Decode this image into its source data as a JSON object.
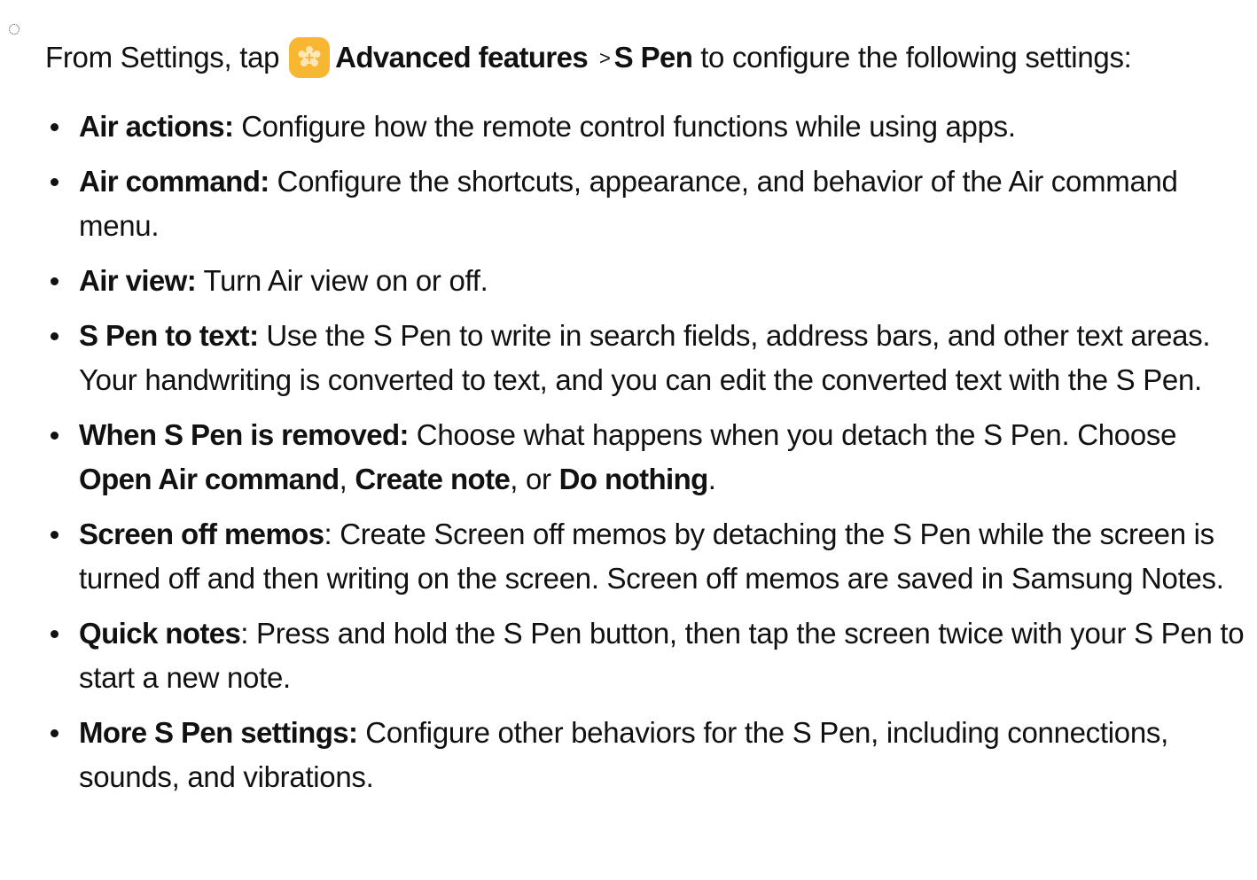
{
  "intro": {
    "prefix": "From Settings, tap",
    "icon": "advanced-features-icon",
    "path_1": "Advanced features",
    "separator": ">",
    "path_2": "S Pen",
    "suffix": "to configure the following settings:"
  },
  "settings": [
    {
      "term": "Air actions:",
      "description": "Configure how the remote control functions while using apps."
    },
    {
      "term": "Air command:",
      "description": "Configure the shortcuts, appearance, and behavior of the Air command menu."
    },
    {
      "term": "Air view:",
      "description": "Turn Air view on or off."
    },
    {
      "term": "S Pen to text:",
      "description": "Use the S Pen to write in search fields, address bars, and other text areas. Your handwriting is converted to text, and you can edit the converted text with the S Pen."
    },
    {
      "term": "When S Pen is removed:",
      "description": "Choose what happens when you detach the S Pen. Choose",
      "option_1": "Open Air command",
      "comma": ",",
      "option_2": "Create note",
      "or_text": ", or",
      "option_3": "Do nothing",
      "end": "."
    },
    {
      "term": "Screen off memos",
      "colon": ":",
      "description": "Create Screen off memos by detaching the S Pen while the screen is turned off and then writing on the screen. Screen off memos are saved in Samsung Notes."
    },
    {
      "term": "Quick notes",
      "colon": ":",
      "description": "Press and hold the S Pen button, then tap the screen twice with your S Pen to start a new note."
    },
    {
      "term": "More S Pen settings:",
      "description": "Configure other behaviors for the S Pen, including connections, sounds, and vibrations."
    }
  ],
  "colors": {
    "icon_background": "#f7b733",
    "text": "#111111"
  }
}
